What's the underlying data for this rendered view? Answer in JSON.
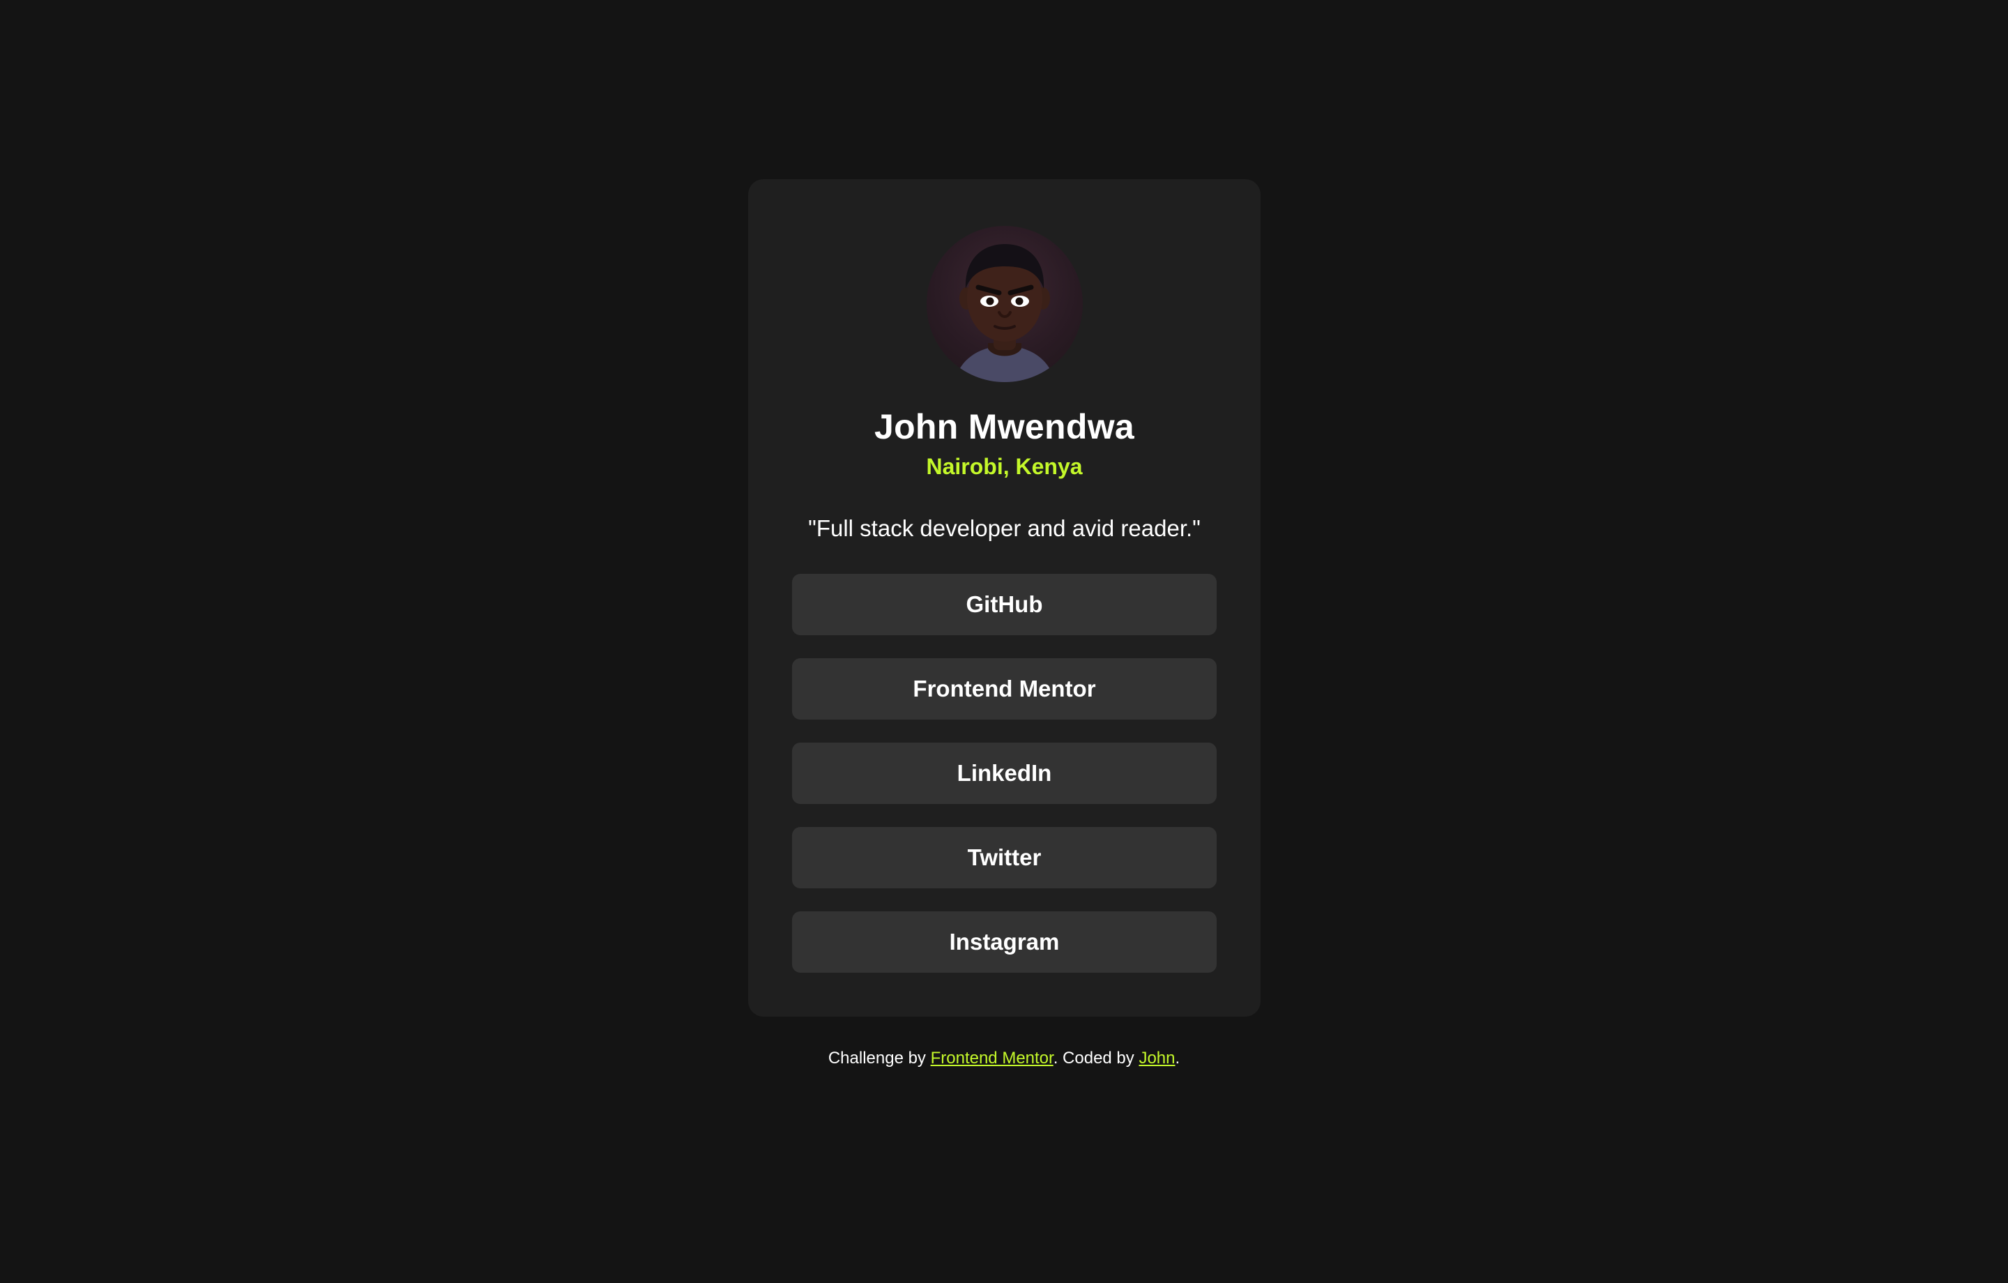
{
  "colors": {
    "page_background": "#141414",
    "card_background": "#1f1f1f",
    "button_background": "#333333",
    "accent": "#c4f82a",
    "text": "#ffffff"
  },
  "profile": {
    "avatar_icon": "avatar-illustration-icon",
    "name": "John Mwendwa",
    "location": "Nairobi, Kenya",
    "bio": "\"Full stack developer and avid reader.\""
  },
  "links": [
    {
      "label": "GitHub"
    },
    {
      "label": "Frontend Mentor"
    },
    {
      "label": "LinkedIn"
    },
    {
      "label": "Twitter"
    },
    {
      "label": "Instagram"
    }
  ],
  "footer": {
    "prefix": "Challenge by ",
    "challenge_link": "Frontend Mentor",
    "middle": ". Coded by ",
    "author_link": "John",
    "suffix": "."
  }
}
